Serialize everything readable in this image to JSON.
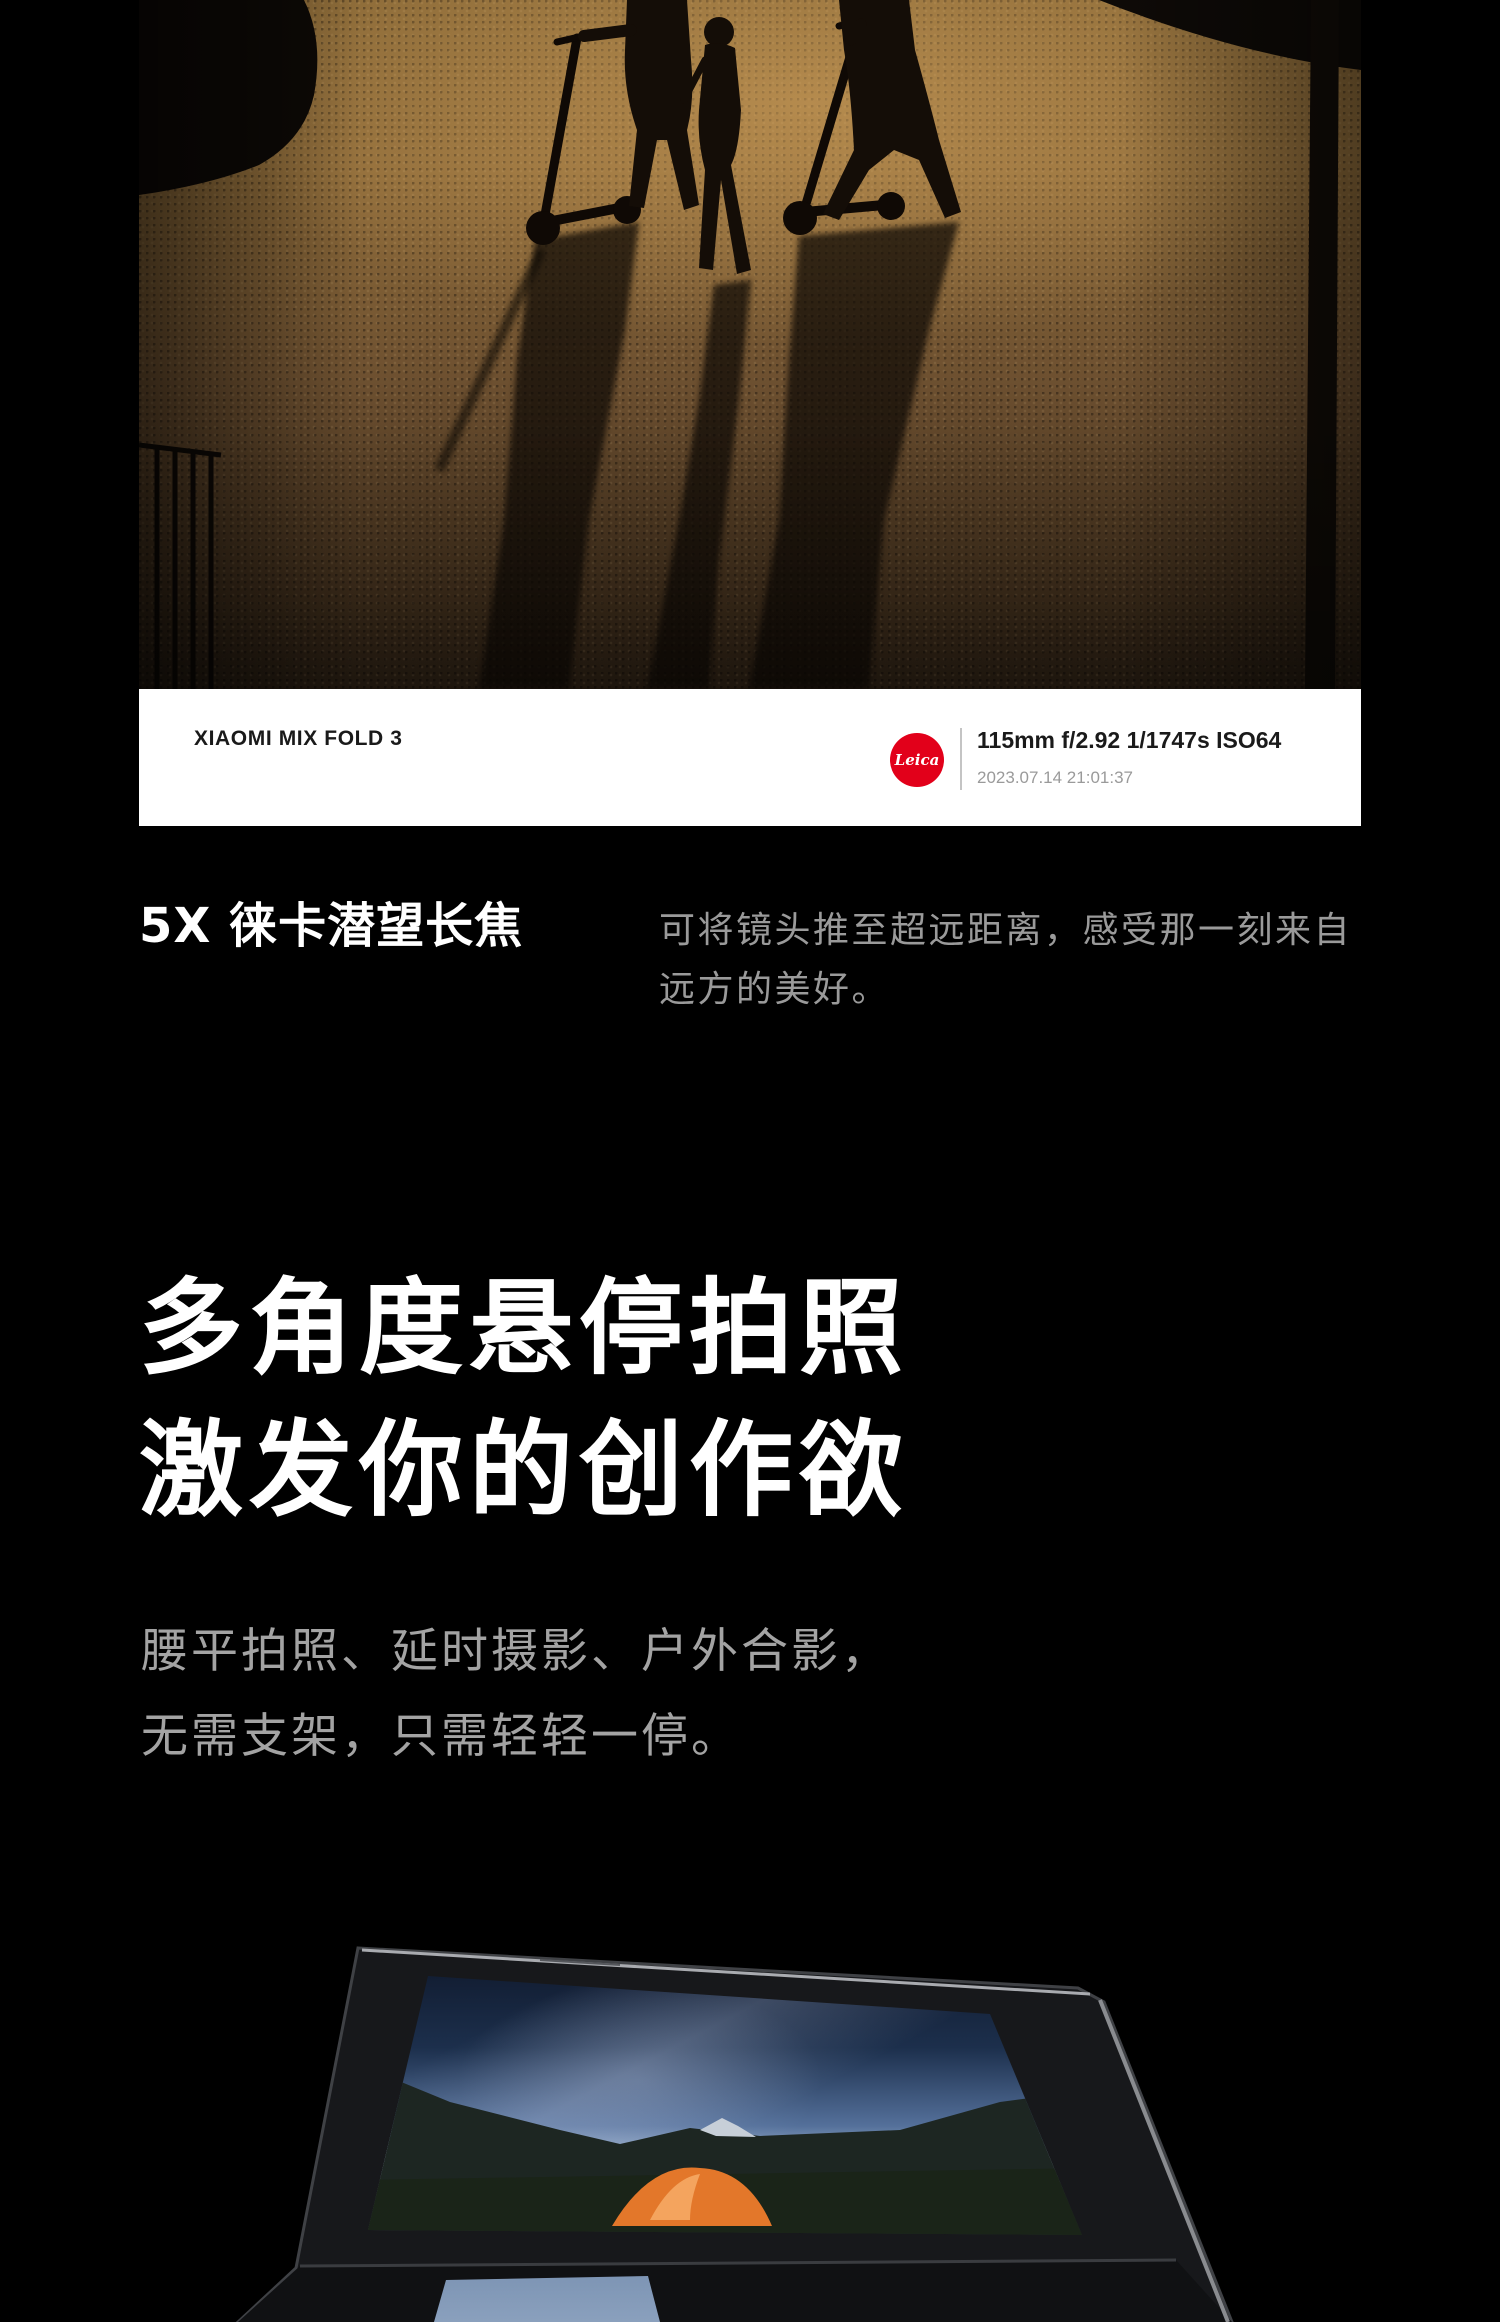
{
  "photo": {
    "caption": {
      "device": "XIAOMI MIX FOLD 3",
      "logo": "Leica",
      "exif": "115mm f/2.92 1/1747s ISO64",
      "timestamp": "2023.07.14 21:01:37"
    }
  },
  "feature": {
    "title": "5X 徕卡潜望长焦",
    "description_lines": [
      "可将镜头推至超远距离，感受那一刻来自",
      "远方的美好。"
    ]
  },
  "hover": {
    "headline_lines": [
      "多角度悬停拍照",
      "激发你的创作欲"
    ],
    "subtitle_lines": [
      "腰平拍照、延时摄影、户外合影，",
      "无需支架，只需轻轻一停。"
    ]
  },
  "colors": {
    "background": "#000000",
    "caption_background": "#ffffff",
    "leica_red": "#e2001a",
    "tent_orange": "#e3772a"
  }
}
